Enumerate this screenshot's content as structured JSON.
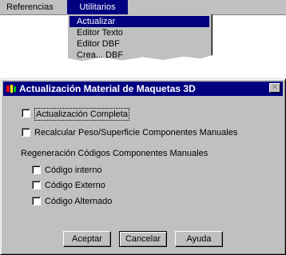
{
  "menubar": {
    "items": [
      {
        "label": "Referencias"
      },
      {
        "label": "Utilitarios"
      }
    ]
  },
  "dropdown": {
    "items": [
      {
        "label": "Actualizar",
        "selected": true
      },
      {
        "label": "Editor Texto"
      },
      {
        "label": "Editor DBF"
      },
      {
        "label": "Crea... DBF"
      }
    ]
  },
  "dialog": {
    "title": "Actualización Material de Maquetas 3D",
    "close_symbol": "✕",
    "options": {
      "full_update": {
        "label": "Actualización Completa",
        "checked": false
      },
      "recalc_weight": {
        "label": "Recalcular Peso/Superficie Componentes Manuales",
        "checked": false
      }
    },
    "group_label": "Regeneración Códigos Componentes Manuales",
    "codes": [
      {
        "label": "Código interno",
        "checked": false
      },
      {
        "label": "Código Externo",
        "checked": false
      },
      {
        "label": "Código Alternado",
        "checked": false
      }
    ],
    "buttons": {
      "accept": "Aceptar",
      "cancel": "Cancelar",
      "help": "Ayuda"
    }
  },
  "colors": {
    "face": "#c0c0c0",
    "titlebar": "#000080",
    "highlight": "#000080"
  },
  "icons": [
    "app-icon",
    "close-icon"
  ]
}
